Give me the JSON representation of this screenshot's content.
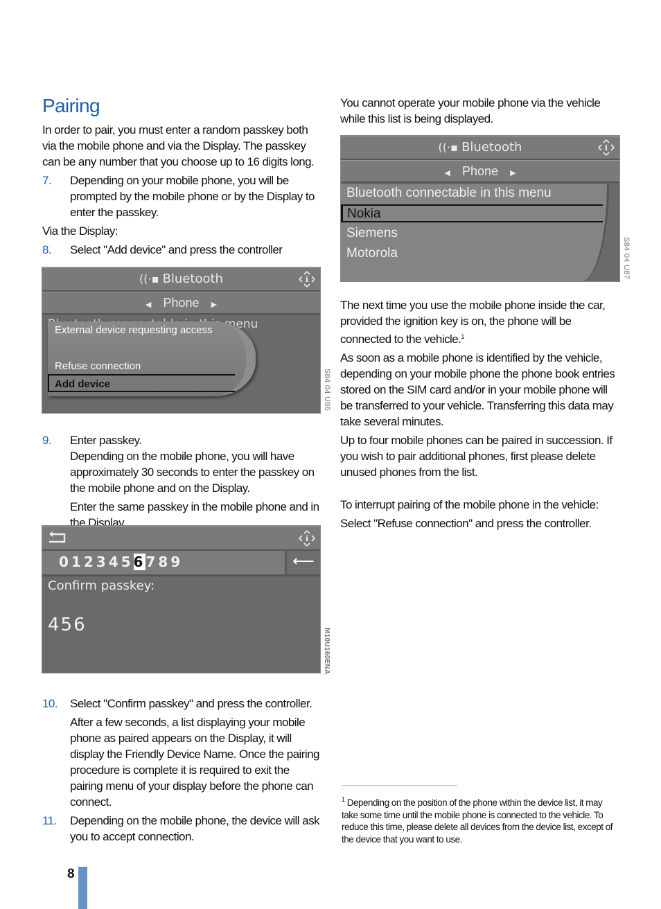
{
  "page": {
    "number": "8",
    "accent_color": "#1f5fa8",
    "page_bar_color": "#6792c8"
  },
  "left": {
    "title": "Pairing",
    "intro": "In order to pair, you must enter a random passkey both via the mobile phone and via the Display. The passkey can be any number that you choose up to 16 digits long.",
    "step7": {
      "num": "7.",
      "text": "Depending on your mobile phone, you will be prompted by the mobile phone or by the Display to enter the passkey."
    },
    "via_display": "Via the Display:",
    "step8": {
      "num": "8.",
      "text": "Select \"Add device\" and press the controller"
    },
    "step9": {
      "num": "9.",
      "text": "Enter passkey.",
      "text2": "Depending on the mobile phone, you will have approximately 30 seconds to enter the passkey on the mobile phone and on the Display.",
      "text3": "Enter the same passkey in the mobile phone and in the Display."
    },
    "step10": {
      "num": "10.",
      "text": "Select \"Confirm passkey\" and press the controller.",
      "text2": "After a few seconds, a list displaying your mobile phone as paired appears on the Display, it will display the Friendly Device Name. Once the pairing procedure is complete it is required to exit the pairing menu of your display before the phone can connect."
    },
    "step11": {
      "num": "11.",
      "text": "Depending on the mobile phone, the device will ask you to accept connection."
    }
  },
  "screen1": {
    "title": "Bluetooth",
    "title_icon": "bluetooth-signal-icon",
    "subtitle": "Phone",
    "background_text": "Bluetooth connectable in this menu",
    "popup_title": "External device requesting access",
    "options": [
      "Refuse connection",
      "Add device"
    ],
    "selected": "Add device",
    "caption": "S84 04 U86"
  },
  "screen2": {
    "back_icon": "back-arrow-icon",
    "digits": [
      "0",
      "1",
      "2",
      "3",
      "4",
      "5",
      "6",
      "7",
      "8",
      "9"
    ],
    "selected_digit": "6",
    "delete_icon": "backspace-icon",
    "label": "Confirm passkey:",
    "value": "456",
    "caption": "M10U160ENA"
  },
  "right": {
    "intro": "You cannot operate your mobile phone via the vehicle while this list is being displayed.",
    "p1": " The next time you use the mobile phone inside the car, provided the ignition key is on, the phone will be connected to the vehicle.",
    "p1_footref": "1",
    "p2": "As soon as a mobile phone is identified by the vehicle, depending on your mobile phone the phone book entries stored on the SIM card and/or in your mobile phone will be transferred to your vehicle. Transferring this data may take several minutes.",
    "p3": "Up to four mobile phones can be paired in succession. If you wish to pair additional phones, first please delete unused phones from the list.",
    "p4": "To interrupt pairing of the mobile phone in the vehicle:",
    "p5": "Select \"Refuse connection\" and press the controller."
  },
  "screen3": {
    "title": "Bluetooth",
    "subtitle": "Phone",
    "items": [
      "Bluetooth connectable in this menu",
      "Nokia",
      "Siemens",
      "Motorola"
    ],
    "selected": "Nokia",
    "caption": "S84 04 U87"
  },
  "footnote": {
    "marker": "1",
    "text": " Depending on the position of the phone within the device list, it may take some time until the mobile phone is connected to the vehicle. To reduce this time, please delete all devices from the device list, except of the device that you want to use."
  }
}
